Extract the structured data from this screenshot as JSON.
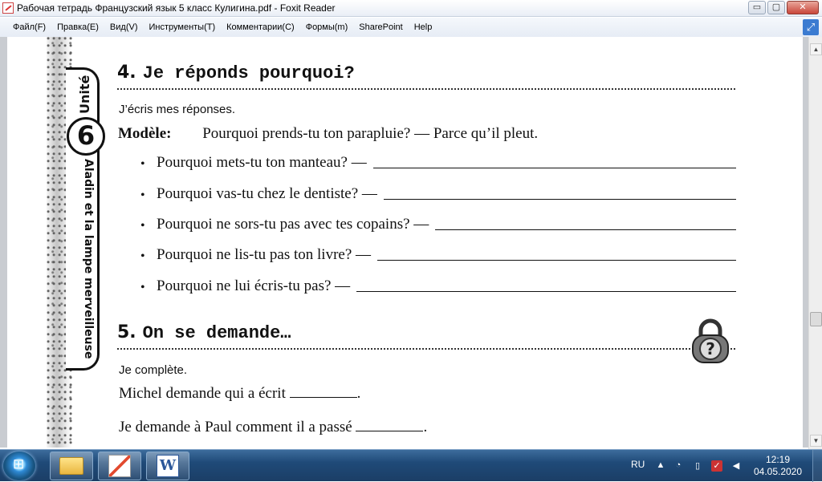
{
  "window": {
    "title": "Рабочая тетрадь Французский язык 5 класс Кулигина.pdf - Foxit Reader",
    "controls": {
      "minimize": "▭",
      "maximize": "▢",
      "close": "✕"
    }
  },
  "menu": {
    "items": [
      "Файл(F)",
      "Правка(E)",
      "Вид(V)",
      "Инструменты(T)",
      "Комментарии(C)",
      "Формы(m)",
      "SharePoint",
      "Help"
    ]
  },
  "page": {
    "unit_word": "Unité",
    "unit_number": "6",
    "unit_title": "Aladin et la lampe merveilleuse",
    "exercise4": {
      "number": "4.",
      "title": "Je réponds pourquoi?",
      "instruction": "J’écris mes réponses.",
      "model_label": "Modèle:",
      "model_text": "Pourquoi prends-tu ton parapluie? — Parce qu’il pleut.",
      "questions": [
        "Pourquoi mets-tu ton manteau? —",
        "Pourquoi vas-tu chez le dentiste? —",
        "Pourquoi ne sors-tu pas avec tes copains? —",
        "Pourquoi ne lis-tu pas ton livre? —",
        "Pourquoi ne lui écris-tu pas? —"
      ]
    },
    "exercise5": {
      "number": "5.",
      "title": "On se demande…",
      "instruction": "Je complète.",
      "sentence1_text": "Michel demande qui a écrit",
      "sentence1_end": ".",
      "sentence2_text": "Je demande à Paul comment il a passé",
      "sentence2_end": "."
    }
  },
  "taskbar": {
    "language": "RU",
    "time": "12:19",
    "date": "04.05.2020"
  }
}
